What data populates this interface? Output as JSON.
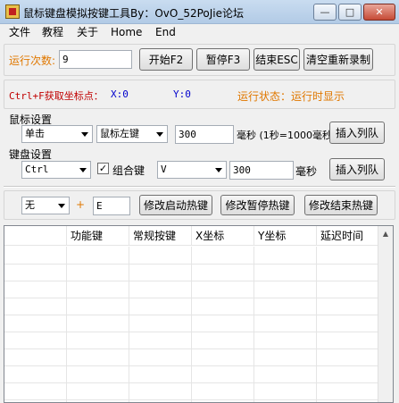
{
  "window": {
    "title": "鼠标键盘模拟按键工具By：OvO_52PoJie论坛",
    "controls": {
      "minimize": "—",
      "maximize": "□",
      "close": "✕"
    }
  },
  "menu": [
    "文件",
    "教程",
    "关于",
    "Home",
    "End"
  ],
  "run_count": {
    "label": "运行次数:",
    "value": "9"
  },
  "buttons": {
    "start": "开始F2",
    "pause": "暂停F3",
    "end": "结束ESC",
    "clear": "清空重新录制"
  },
  "coords": {
    "hint": "Ctrl+F获取坐标点：",
    "x_label": "X:0",
    "y_label": "Y:0",
    "status": "运行状态：运行时显示"
  },
  "mouse": {
    "section": "鼠标设置",
    "action": "单击",
    "button": "鼠标左键",
    "delay": "300",
    "delay_unit": "毫秒 (1秒=1000毫秒)",
    "insert": "插入列队"
  },
  "keyboard": {
    "section": "键盘设置",
    "modifier": "Ctrl",
    "combo_label": "组合键",
    "combo_checked": true,
    "key": "V",
    "delay": "300",
    "delay_unit": "毫秒",
    "insert": "插入列队"
  },
  "hotkey": {
    "modifier": "无",
    "plus": "+",
    "key": "E",
    "start_btn": "修改启动热键",
    "pause_btn": "修改暂停热键",
    "end_btn": "修改结束热键"
  },
  "table": {
    "columns": [
      "功能键",
      "常规按键",
      "X坐标",
      "Y坐标",
      "延迟时间"
    ],
    "rows": []
  },
  "colors": {
    "accent_orange": "#e07800",
    "hint_red": "#c00000",
    "coord_blue": "#0000cc"
  }
}
